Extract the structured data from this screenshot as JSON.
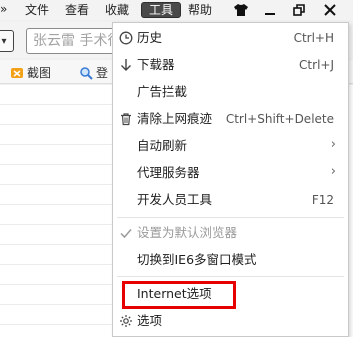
{
  "menubar": {
    "chevron": "»",
    "items": [
      "文件",
      "查看",
      "收藏",
      "工具",
      "帮助"
    ],
    "active_item": "工具",
    "window_controls": [
      "shirt-icon",
      "minimize-icon",
      "restore-icon",
      "close-icon"
    ]
  },
  "address": {
    "search_text": "张云雷 手术徐"
  },
  "favorites": {
    "items": [
      "截图",
      "登"
    ]
  },
  "menu": {
    "items": [
      {
        "label": "历史",
        "shortcut": "Ctrl+H",
        "icon": "clock-icon"
      },
      {
        "label": "下载器",
        "shortcut": "Ctrl+J",
        "icon": "download-arrow-icon"
      },
      {
        "label": "广告拦截",
        "shortcut": "",
        "icon": ""
      },
      {
        "label": "清除上网痕迹",
        "shortcut": "Ctrl+Shift+Delete",
        "icon": "trash-icon"
      },
      {
        "label": "自动刷新",
        "shortcut": "",
        "icon": "",
        "submenu": true
      },
      {
        "label": "代理服务器",
        "shortcut": "",
        "icon": "",
        "submenu": true
      },
      {
        "label": "开发人员工具",
        "shortcut": "F12",
        "icon": ""
      },
      {
        "label": "设置为默认浏览器",
        "shortcut": "",
        "icon": "checkmark-icon",
        "disabled": true
      },
      {
        "label": "切换到IE6多窗口模式",
        "shortcut": "",
        "icon": ""
      },
      {
        "label": "Internet选项",
        "shortcut": "",
        "icon": "",
        "highlighted": true
      },
      {
        "label": "选项",
        "shortcut": "",
        "icon": "gear-icon"
      }
    ]
  },
  "colors": {
    "highlight_border": "#e60000",
    "menu_bg": "#ffffff",
    "active_menu_bg": "#4a4a4a"
  }
}
